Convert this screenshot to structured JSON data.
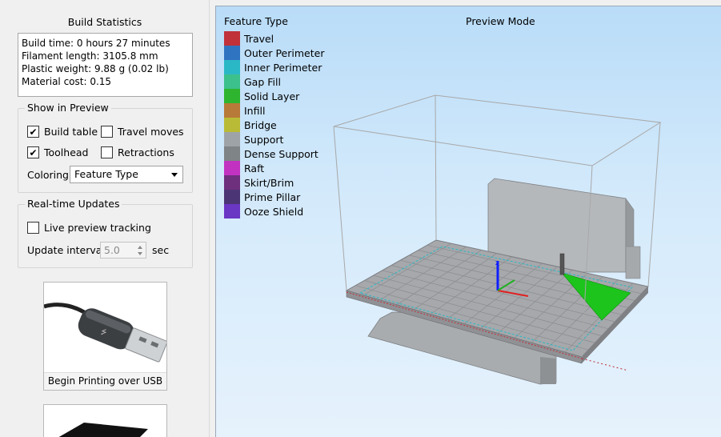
{
  "build_stats": {
    "title": "Build Statistics",
    "lines": [
      "Build time: 0 hours 27 minutes",
      "Filament length: 3105.8 mm",
      "Plastic weight: 9.88 g (0.02 lb)",
      "Material cost: 0.15"
    ]
  },
  "show_in_preview": {
    "title": "Show in Preview",
    "build_table": {
      "label": "Build table",
      "checked": true
    },
    "travel_moves": {
      "label": "Travel moves",
      "checked": false
    },
    "toolhead": {
      "label": "Toolhead",
      "checked": true
    },
    "retractions": {
      "label": "Retractions",
      "checked": false
    },
    "coloring_label": "Coloring",
    "coloring_value": "Feature Type"
  },
  "realtime": {
    "title": "Real-time Updates",
    "live_tracking": {
      "label": "Live preview tracking",
      "checked": false
    },
    "interval_label": "Update interval",
    "interval_value": "5.0",
    "interval_unit": "sec"
  },
  "usb_button": {
    "label": "Begin Printing over USB",
    "icon": "usb-cable-icon"
  },
  "sd_button": {
    "icon": "sd-card-icon"
  },
  "preview": {
    "legend_title": "Feature Type",
    "mode_title": "Preview Mode",
    "legend": [
      {
        "label": "Travel",
        "color": "#c0313a"
      },
      {
        "label": "Outer Perimeter",
        "color": "#2f74c0"
      },
      {
        "label": "Inner Perimeter",
        "color": "#2bb8c6"
      },
      {
        "label": "Gap Fill",
        "color": "#3cc08c"
      },
      {
        "label": "Solid Layer",
        "color": "#2fb42f"
      },
      {
        "label": "Infill",
        "color": "#b87a38"
      },
      {
        "label": "Bridge",
        "color": "#b9bb36"
      },
      {
        "label": "Support",
        "color": "#9ea3a8"
      },
      {
        "label": "Dense Support",
        "color": "#7f8487"
      },
      {
        "label": "Raft",
        "color": "#c132c1"
      },
      {
        "label": "Skirt/Brim",
        "color": "#6e2f7c"
      },
      {
        "label": "Prime Pillar",
        "color": "#4c3575"
      },
      {
        "label": "Ooze Shield",
        "color": "#6a36c4"
      }
    ]
  }
}
